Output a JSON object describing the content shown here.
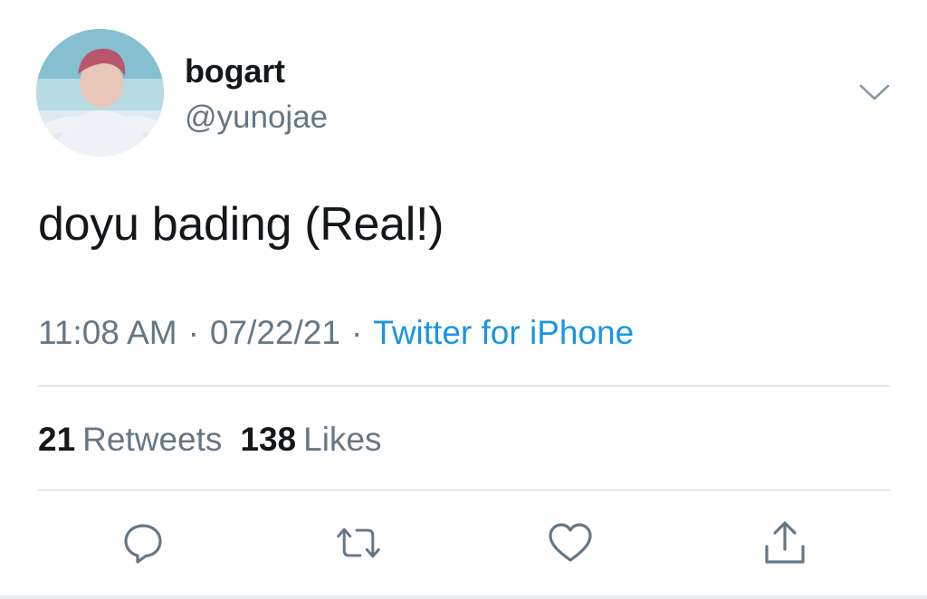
{
  "user": {
    "display_name": "bogart",
    "handle": "@yunojae"
  },
  "tweet": {
    "text": "doyu bading (Real!)",
    "time": "11:08 AM",
    "date": "07/22/21",
    "separator": "·",
    "source": "Twitter for iPhone"
  },
  "stats": {
    "retweets_count": "21",
    "retweets_label": "Retweets",
    "likes_count": "138",
    "likes_label": "Likes"
  },
  "icons": {
    "more": "chevron-down-icon",
    "reply": "reply-icon",
    "retweet": "retweet-icon",
    "like": "heart-icon",
    "share": "share-icon"
  },
  "colors": {
    "text": "#14171a",
    "secondary": "#657786",
    "link": "#1b95e0",
    "divider": "#cfd5da"
  }
}
